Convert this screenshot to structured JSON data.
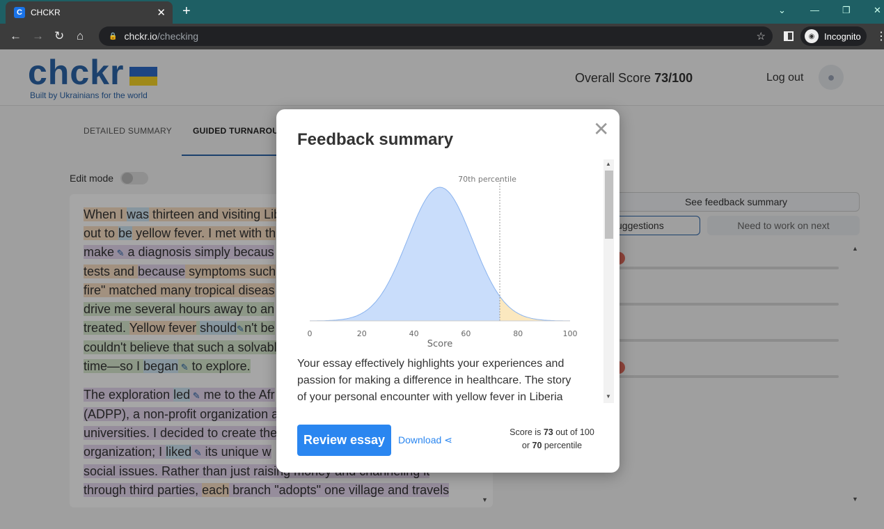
{
  "browser": {
    "tab_title": "CHCKR",
    "tab_favicon": "C",
    "url_host": "chckr.io",
    "url_path": "/checking",
    "incognito_label": "Incognito"
  },
  "header": {
    "logo": "chckr",
    "tagline": "Built by Ukrainians for the world",
    "overall_label": "Overall Score",
    "overall_value": "73/100",
    "logout": "Log out"
  },
  "tabs": [
    "DETAILED SUMMARY",
    "GUIDED TURNAROUN"
  ],
  "edit_mode_label": "Edit mode",
  "essay": {
    "p1_lines": [
      [
        "When I ",
        "was",
        " thirteen and visiting Lib"
      ],
      [
        "out to ",
        "be",
        " yellow fever. I met with th"
      ],
      [
        "make",
        " a diagnosis simply ",
        "becaus"
      ],
      [
        "tests and ",
        "because",
        " symptoms such"
      ],
      [
        "fire\" matched many tropical diseas"
      ],
      [
        "drive me several hours away to an"
      ],
      [
        "treated. ",
        "Yellow fever",
        " ",
        "should",
        "n't be"
      ],
      [
        "couldn't believe that such a solvabl"
      ],
      [
        "time—so I ",
        "began",
        " to explore."
      ]
    ],
    "p2_lines": [
      [
        "The exploration ",
        "led",
        " me to the Afr"
      ],
      [
        "(ADPP), a non-profit organization a"
      ],
      [
        "universities. I decided to create the"
      ],
      [
        "organization; I ",
        "liked",
        " its unique w"
      ],
      [
        "social issues. Rather than just raising money and channeling it"
      ],
      [
        "through third parties, ",
        "each",
        " branch \"adopts\" one village and travels"
      ]
    ]
  },
  "right_panel": {
    "see_feedback": "See feedback summary",
    "suggestions": "uggestions",
    "need_to_work": "Need to work on next"
  },
  "modal": {
    "title": "Feedback summary",
    "close_icon": "close-icon",
    "body": "Your essay effectively highlights your experiences and passion for making a difference in healthcare. The story of your personal encounter with yellow fever in Liberia",
    "review_button": "Review essay",
    "download": "Download",
    "score_prefix": "Score is",
    "score_value": "73",
    "score_mid": "out of 100",
    "or": "or",
    "percentile_value": "70",
    "percentile_label": "percentile"
  },
  "chart_data": {
    "type": "area",
    "xlabel": "Score",
    "ticks": [
      "0",
      "20",
      "40",
      "60",
      "80",
      "100"
    ],
    "xlim": [
      0,
      100
    ],
    "distribution": "normal",
    "mean": 50,
    "marker_x": 73,
    "marker_label": "70th percentile",
    "colors": {
      "below": "#c9ddfb",
      "above": "#fbe8bf",
      "line": "#8ab3ee"
    }
  }
}
